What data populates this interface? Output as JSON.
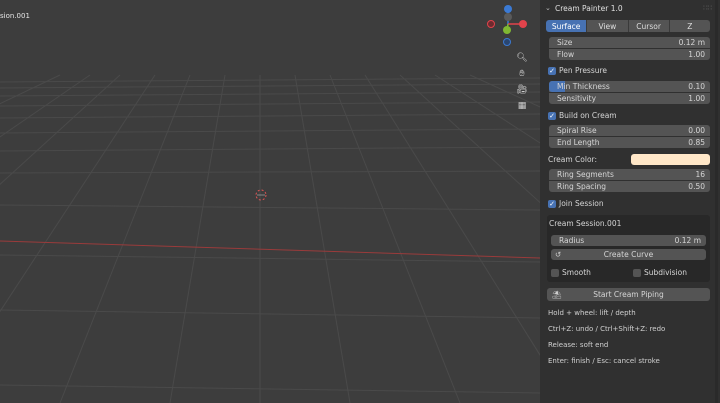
{
  "viewport": {
    "label": "sion.001"
  },
  "gizmo": {
    "x_color": "#e2434b",
    "y_color": "#80b832",
    "z_color": "#3b7ad4"
  },
  "panel": {
    "title": "Cream Painter 1.0",
    "tabs": [
      "Surface",
      "View",
      "Cursor",
      "Z"
    ],
    "size": {
      "label": "Size",
      "value": "0.12 m"
    },
    "flow": {
      "label": "Flow",
      "value": "1.00"
    },
    "pen_pressure": {
      "label": "Pen Pressure",
      "checked": true
    },
    "min_thickness": {
      "label": "Min Thickness",
      "value": "0.10",
      "fraction": 0.1
    },
    "sensitivity": {
      "label": "Sensitivity",
      "value": "1.00"
    },
    "build_on_cream": {
      "label": "Build on Cream",
      "checked": true
    },
    "spiral_rise": {
      "label": "Spiral Rise",
      "value": "0.00"
    },
    "end_length": {
      "label": "End Length",
      "value": "0.85"
    },
    "cream_color": {
      "label": "Cream Color:",
      "color": "#ffe7c8"
    },
    "ring_segments": {
      "label": "Ring Segments",
      "value": "16"
    },
    "ring_spacing": {
      "label": "Ring Spacing",
      "value": "0.50"
    },
    "join_session": {
      "label": "Join Session",
      "checked": true
    },
    "session": {
      "name": "Cream Session.001",
      "radius": {
        "label": "Radius",
        "value": "0.12 m"
      },
      "create_curve": "Create Curve",
      "smooth": {
        "label": "Smooth",
        "checked": false
      },
      "subdivision": {
        "label": "Subdivision",
        "checked": false
      }
    },
    "start_button": "Start Cream Piping",
    "notes": [
      "Hold + wheel: lift / depth",
      "Ctrl+Z: undo / Ctrl+Shift+Z: redo",
      "Release: soft end",
      "Enter: finish / Esc: cancel stroke"
    ]
  }
}
